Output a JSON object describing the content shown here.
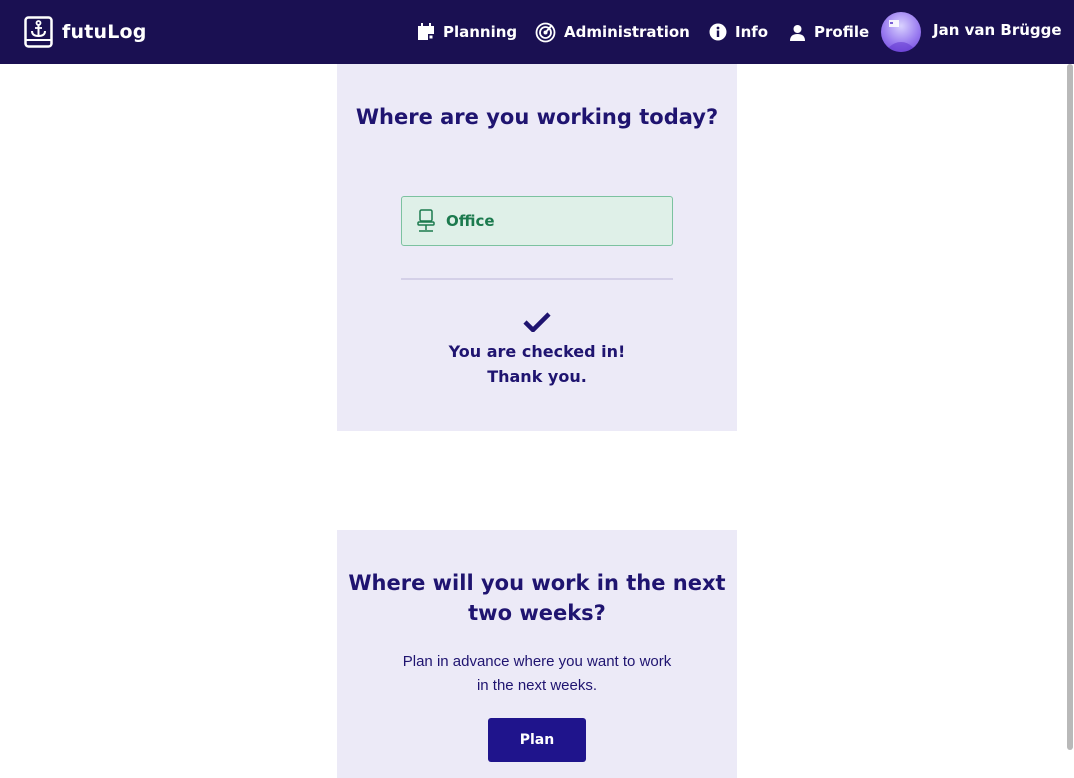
{
  "app": {
    "name": "futuLog"
  },
  "nav": {
    "items": [
      {
        "label": "Planning",
        "icon": "calendar-icon"
      },
      {
        "label": "Administration",
        "icon": "admin-icon"
      },
      {
        "label": "Info",
        "icon": "info-icon"
      },
      {
        "label": "Profile",
        "icon": "profile-icon"
      }
    ],
    "user_name": "Jan van Brügge"
  },
  "checkin_card": {
    "title": "Where are you working today?",
    "location_label": "Office",
    "location_icon": "office-chair-icon",
    "status_line1": "You are checked in!",
    "status_line2": "Thank you."
  },
  "plan_card": {
    "title": "Where will you work in the next two weeks?",
    "description": "Plan in advance where you want to work in the next weeks.",
    "button_label": "Plan"
  },
  "colors": {
    "navbar": "#1a1052",
    "card_bg": "#eceaf7",
    "primary_text": "#1f1470",
    "office_green": "#1c7a4e",
    "button": "#1f148c"
  }
}
